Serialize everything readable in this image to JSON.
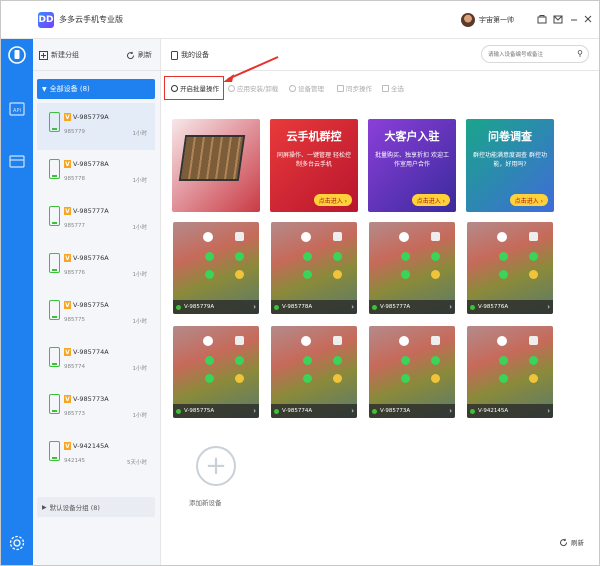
{
  "app": {
    "logo": "DD",
    "title": "多多云手机专业版",
    "user_name": "宇宙第一帅",
    "window_controls": [
      "store-icon",
      "mail-icon",
      "minimize-icon",
      "close-icon"
    ]
  },
  "sidebar": {
    "new_group": "新建分组",
    "refresh": "刷新",
    "all_group": "全部设备 (8)",
    "devices": [
      {
        "name": "V-985779A",
        "sub": "985779",
        "time": "1小时"
      },
      {
        "name": "V-985778A",
        "sub": "985778",
        "time": "1小时"
      },
      {
        "name": "V-985777A",
        "sub": "985777",
        "time": "1小时"
      },
      {
        "name": "V-985776A",
        "sub": "985776",
        "time": "1小时"
      },
      {
        "name": "V-985775A",
        "sub": "985775",
        "time": "1小时"
      },
      {
        "name": "V-985774A",
        "sub": "985774",
        "time": "1小时"
      },
      {
        "name": "V-985773A",
        "sub": "985773",
        "time": "1小时"
      },
      {
        "name": "V-942145A",
        "sub": "942145",
        "time": "5天小时"
      }
    ],
    "default_group": "默认设备分组 (8)"
  },
  "main": {
    "my_devices": "我的设备",
    "search_placeholder": "请输入设备编号或备注",
    "toolbar": {
      "batch": "开启批量操作",
      "install": "应用安装/卸载",
      "manage": "设备管理",
      "sync": "同步操作",
      "select_all": "全选"
    },
    "banners": [
      {
        "title": "",
        "text": "",
        "cta": ""
      },
      {
        "title": "云手机群控",
        "text": "同屏操作、一键管理 轻松控制多台云手机",
        "cta": "点击进入 ›"
      },
      {
        "title": "大客户入驻",
        "text": "批量购买、独享折扣 欢迎工作室用户合作",
        "cta": "点击进入 ›"
      },
      {
        "title": "问卷调查",
        "text": "群控功能满意度调查 群控功能，好用吗?",
        "cta": "点击进入 ›"
      }
    ],
    "cards": [
      {
        "name": "V-985779A"
      },
      {
        "name": "V-985778A"
      },
      {
        "name": "V-985777A"
      },
      {
        "name": "V-985776A"
      },
      {
        "name": "V-985775A"
      },
      {
        "name": "V-985774A"
      },
      {
        "name": "V-985773A"
      },
      {
        "name": "V-942145A"
      }
    ],
    "add_device": "添加新设备",
    "refresh": "刷新"
  },
  "colors": {
    "accent": "#1f80f0",
    "online": "#3cc13c",
    "highlight": "#e5332a"
  }
}
